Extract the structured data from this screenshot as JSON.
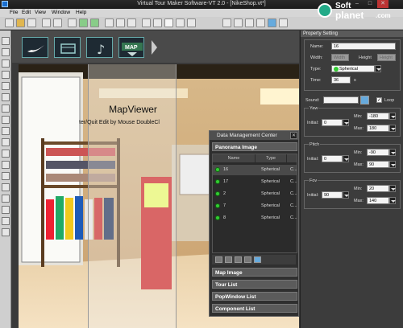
{
  "window": {
    "title": "Virtual Tour Maker Software-VT 2.0 - [NikeShop.vt*]",
    "min": "–",
    "max": "□",
    "close": "✕"
  },
  "menu": [
    "File",
    "Edit",
    "View",
    "Window",
    "Help"
  ],
  "thumbnails": [
    {
      "label": "✓"
    },
    {
      "label": "▦"
    },
    {
      "label": "♪"
    },
    {
      "label": "MAP"
    }
  ],
  "mapviewer": {
    "title": "MapViewer",
    "subtitle": "ter/Quit Edit by Mouse DoubleCl"
  },
  "properties": {
    "header": "Property Setting",
    "name_label": "Name:",
    "name_value": "16",
    "width_label": "Width:",
    "width_value": "Width",
    "height_label": "Height",
    "height_value": "Height",
    "type_label": "Type:",
    "type_value": "Spherical",
    "time_label": "Time:",
    "time_value": "36",
    "time_unit": "s",
    "sound_label": "Sound:",
    "loop_label": "Loop",
    "yaw": {
      "title": "Yaw",
      "initial_label": "Initial:",
      "initial": "0",
      "min_label": "Min:",
      "min": "-180",
      "max_label": "Max:",
      "max": "180"
    },
    "pitch": {
      "title": "Pitch",
      "initial_label": "Initial:",
      "initial": "0",
      "min_label": "Min:",
      "min": "-90",
      "max_label": "Max:",
      "max": "90"
    },
    "fov": {
      "title": "Fov",
      "initial_label": "Initial:",
      "initial": "90",
      "min_label": "Min:",
      "min": "20",
      "max_label": "Max:",
      "max": "140"
    }
  },
  "dmc": {
    "title": "Data Management Center",
    "close": "✕",
    "panorama_section": "Panorama Image",
    "col_name": "Name",
    "col_type": "Type",
    "rows": [
      {
        "name": "16",
        "type": "Spherical",
        "c": "C..."
      },
      {
        "name": "17",
        "type": "Spherical",
        "c": "C..."
      },
      {
        "name": "2",
        "type": "Spherical",
        "c": "C..."
      },
      {
        "name": "7",
        "type": "Spherical",
        "c": "C..."
      },
      {
        "name": "8",
        "type": "Spherical",
        "c": "C..."
      }
    ],
    "sections": [
      "Map Image",
      "Tour List",
      "PopWindow List",
      "Component List"
    ]
  },
  "watermark": {
    "line1": "Soft",
    "line2": "planet",
    "suffix": ".com"
  },
  "colors": {
    "accent": "#1a6fd0",
    "status_dot": "#33cc33"
  }
}
